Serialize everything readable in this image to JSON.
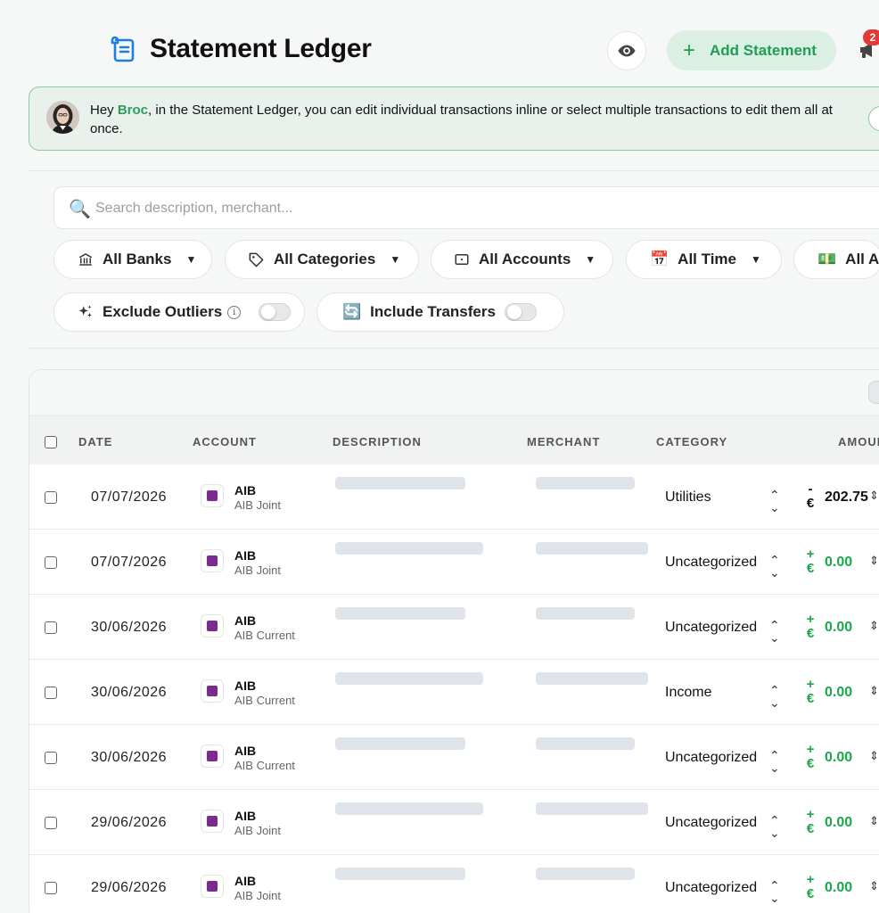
{
  "header": {
    "title": "Statement Ledger",
    "add_button_label": "Add Statement",
    "notification_count": "2"
  },
  "banner": {
    "greeting": "Hey ",
    "user_name": "Broc",
    "message": ", in the Statement Ledger, you can edit individual transactions inline or select multiple transactions to edit them all at once."
  },
  "search": {
    "placeholder": "Search description, merchant..."
  },
  "filters": {
    "banks": "All Banks",
    "categories": "All Categories",
    "accounts": "All Accounts",
    "time": "All Time",
    "amounts": "All A",
    "exclude_outliers": "Exclude Outliers",
    "include_transfers": "Include Transfers"
  },
  "table": {
    "columns": {
      "date": "DATE",
      "account": "ACCOUNT",
      "description": "DESCRIPTION",
      "merchant": "MERCHANT",
      "category": "CATEGORY",
      "amount": "AMOUN"
    },
    "rows": [
      {
        "date": "07/07/2026",
        "bank": "AIB",
        "account": "AIB Joint",
        "category": "Utilities",
        "sign": "-",
        "currency": "€",
        "amount": "202.75"
      },
      {
        "date": "07/07/2026",
        "bank": "AIB",
        "account": "AIB Joint",
        "category": "Uncategorized",
        "sign": "+",
        "currency": "€",
        "amount": "0.00"
      },
      {
        "date": "30/06/2026",
        "bank": "AIB",
        "account": "AIB Current",
        "category": "Uncategorized",
        "sign": "+",
        "currency": "€",
        "amount": "0.00"
      },
      {
        "date": "30/06/2026",
        "bank": "AIB",
        "account": "AIB Current",
        "category": "Income",
        "sign": "+",
        "currency": "€",
        "amount": "0.00"
      },
      {
        "date": "30/06/2026",
        "bank": "AIB",
        "account": "AIB Current",
        "category": "Uncategorized",
        "sign": "+",
        "currency": "€",
        "amount": "0.00"
      },
      {
        "date": "29/06/2026",
        "bank": "AIB",
        "account": "AIB Joint",
        "category": "Uncategorized",
        "sign": "+",
        "currency": "€",
        "amount": "0.00"
      },
      {
        "date": "29/06/2026",
        "bank": "AIB",
        "account": "AIB Joint",
        "category": "Uncategorized",
        "sign": "+",
        "currency": "€",
        "amount": "0.00"
      }
    ]
  },
  "colors": {
    "accent_green": "#1ea64f",
    "banner_bg": "#e8f1ec",
    "add_button_bg": "#dcefe3",
    "bank_logo": "#7b2b8f"
  }
}
